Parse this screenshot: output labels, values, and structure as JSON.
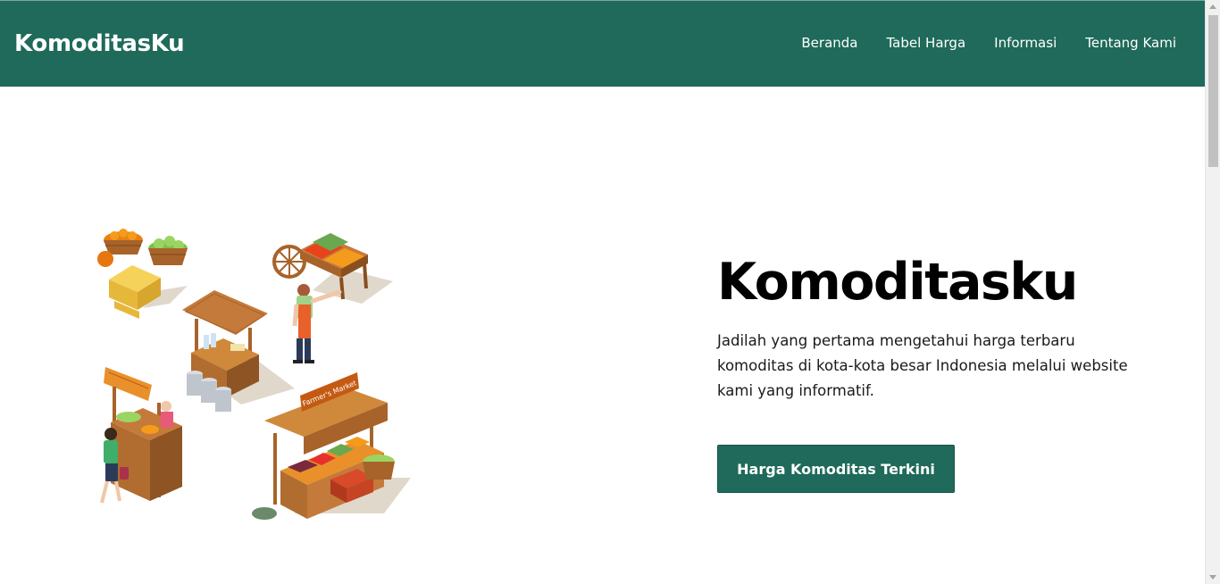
{
  "colors": {
    "brand": "#1f6a5a",
    "text": "#000000",
    "background": "#ffffff"
  },
  "navbar": {
    "brand": "KomoditasKu",
    "links": [
      {
        "label": "Beranda"
      },
      {
        "label": "Tabel Harga"
      },
      {
        "label": "Informasi"
      },
      {
        "label": "Tentang Kami"
      }
    ]
  },
  "hero": {
    "illustration_icon": "market-stalls-illustration",
    "stall_signs": [
      "Farmer's Market"
    ],
    "title": "Komoditasku",
    "description": "Jadilah yang pertama mengetahui harga terbaru komoditas di kota-kota besar Indonesia melalui website kami yang informatif.",
    "cta_label": "Harga Komoditas Terkini"
  }
}
